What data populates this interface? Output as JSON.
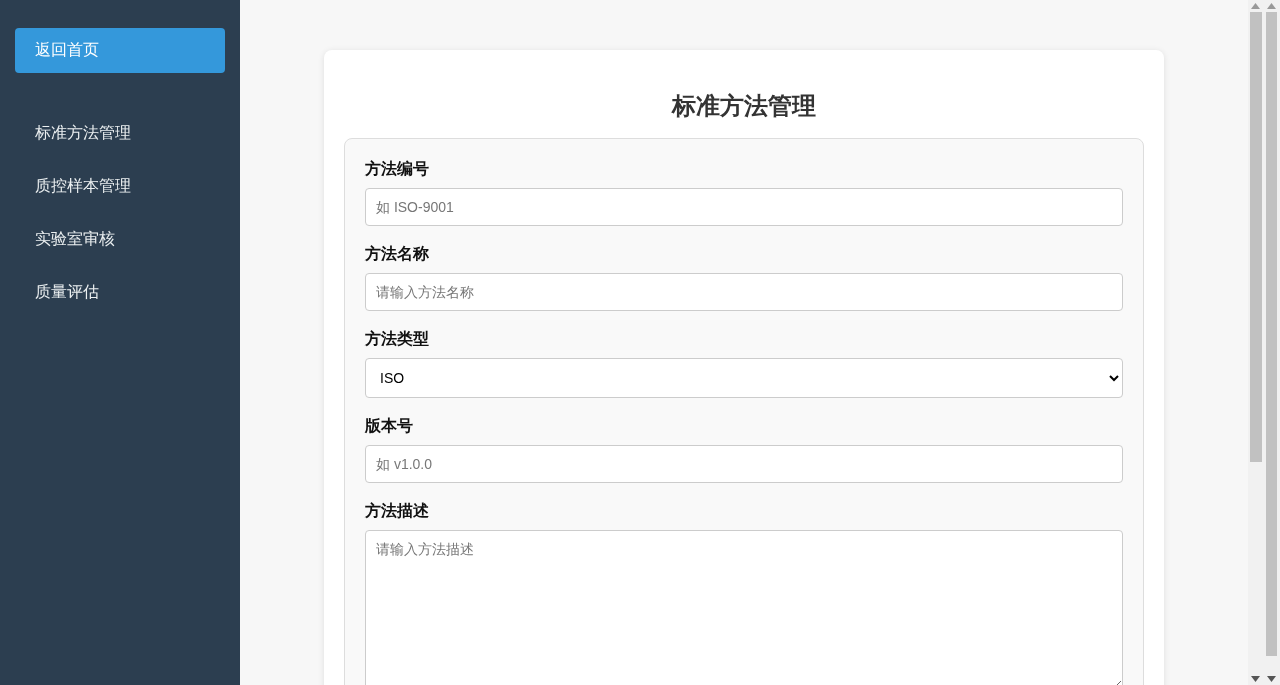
{
  "sidebar": {
    "home_button": "返回首页",
    "items": [
      {
        "label": "标准方法管理"
      },
      {
        "label": "质控样本管理"
      },
      {
        "label": "实验室审核"
      },
      {
        "label": "质量评估"
      }
    ]
  },
  "page": {
    "title": "标准方法管理",
    "fields": [
      {
        "kind": "input",
        "label": "方法编号",
        "placeholder": "如 ISO-9001"
      },
      {
        "kind": "input",
        "label": "方法名称",
        "placeholder": "请输入方法名称"
      },
      {
        "kind": "select",
        "label": "方法类型",
        "value": "ISO"
      },
      {
        "kind": "input",
        "label": "版本号",
        "placeholder": "如 v1.0.0"
      },
      {
        "kind": "textarea",
        "label": "方法描述",
        "placeholder": "请输入方法描述"
      }
    ]
  }
}
